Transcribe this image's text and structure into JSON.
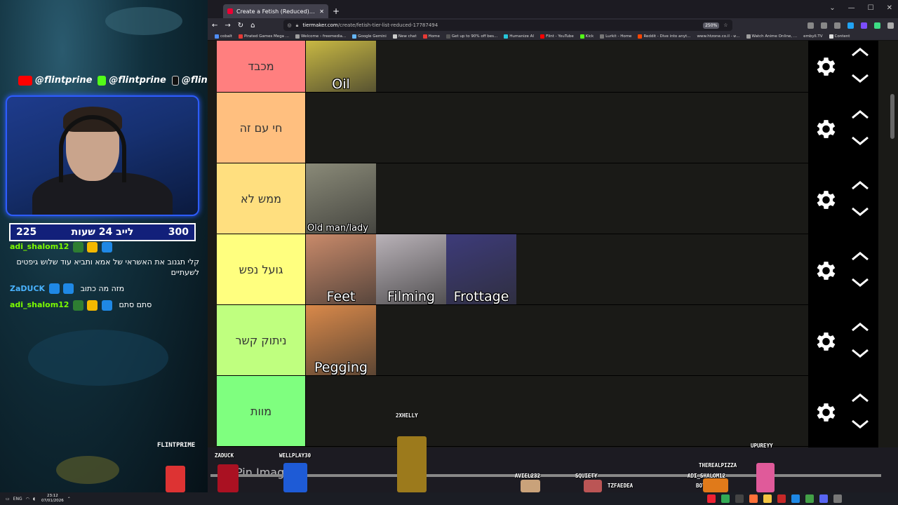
{
  "overlay": {
    "socials": [
      {
        "handle": "@flintprine",
        "icon": "youtube-icon",
        "color": "#ff0000"
      },
      {
        "handle": "@flintprine",
        "icon": "kick-icon",
        "color": "#53fc18"
      },
      {
        "handle": "@flintprine",
        "icon": "tiktok-icon",
        "color": "#111111"
      }
    ],
    "live_bar": {
      "left_count": "225",
      "title": "לייב 24 שעות",
      "right_count": "300"
    },
    "chat": [
      {
        "user": "adi_shalom12",
        "text": "קלי תגנוב את האשראי של אמא ותביא עוד שלוש גיפטים לשעתיים",
        "color": "#7cfc00"
      },
      {
        "user": "ZaDUCK",
        "text": "מזה מה כתוב",
        "color": "#4ab3ff"
      },
      {
        "user": "adi_shalom12",
        "text": "סתם סתם",
        "color": "#7cfc00"
      }
    ],
    "streamer_tag": "FLINTPRIME"
  },
  "browser": {
    "tab_title": "Create a Fetish (Reduced) Tier Li",
    "url_host": "tiermaker.com",
    "url_path": "/create/fetish-tier-list-reduced-17787494",
    "zoom": "250%",
    "bookmarks": [
      "cobalt",
      "Pirated Games Mega ...",
      "Welcome › freemedia...",
      "Google Gemini",
      "New chat",
      "Home",
      "Get up to 90% off bes...",
      "Humanize AI",
      "Flint - YouTube",
      "Kick",
      "Lurkit - Home",
      "Reddit - Dive into anyt...",
      "www.htzone.co.il - ש...",
      "Watch Anime Online, ...",
      "embyll.TV",
      "Content"
    ]
  },
  "tiers": [
    {
      "label": "מכבד",
      "color": "#ff7f7f",
      "items": [
        {
          "caption": "Oil",
          "bg": "#c8b843"
        }
      ]
    },
    {
      "label": "חי עם זה",
      "color": "#ffbf7f",
      "items": []
    },
    {
      "label": "ממש לא",
      "color": "#ffdf7f",
      "items": [
        {
          "caption": "Old man/lady",
          "bg": "#8a8a78",
          "small": true
        }
      ]
    },
    {
      "label": "גועל נפש",
      "color": "#ffff7f",
      "items": [
        {
          "caption": "Feet",
          "bg": "#c98a6a"
        },
        {
          "caption": "Filming",
          "bg": "#b9b2b8"
        },
        {
          "caption": "Frottage",
          "bg": "#3d3b7a"
        }
      ]
    },
    {
      "label": "ניתוק קשר",
      "color": "#bfff7f",
      "items": [
        {
          "caption": "Pegging",
          "bg": "#d9894a"
        }
      ]
    },
    {
      "label": "מוות",
      "color": "#7fff7f",
      "items": []
    }
  ],
  "bottom": {
    "pin_text": "Pin Image",
    "viewers": [
      "ZADUCK",
      "WELLPLAY30",
      "2XHELLY",
      "AVIEL232",
      "SQUIETY",
      "TZFAEDEA",
      "THEREALPIZZA",
      "ADI_SHALOM12",
      "BOTRIX",
      "UPUREYY"
    ]
  },
  "taskbar": {
    "lang": "ENG",
    "time": "23:12",
    "date": "07/01/2026"
  }
}
